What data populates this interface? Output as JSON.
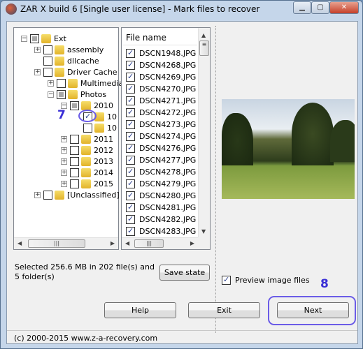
{
  "window": {
    "title": "ZAR X build 6 [Single user license] - Mark files to recover",
    "min": "▁",
    "max": "▢",
    "close": "✕"
  },
  "tree": {
    "items": [
      {
        "label": "Ext",
        "state": "partial",
        "expander": "−",
        "indent": 0
      },
      {
        "label": "assembly",
        "state": "unchecked",
        "expander": "+",
        "indent": 1
      },
      {
        "label": "dllcache",
        "state": "unchecked",
        "expander": "",
        "indent": 1
      },
      {
        "label": "Driver Cache",
        "state": "unchecked",
        "expander": "+",
        "indent": 1
      },
      {
        "label": "Multimedia",
        "state": "unchecked",
        "expander": "+",
        "indent": 2
      },
      {
        "label": "Photos",
        "state": "partial",
        "expander": "−",
        "indent": 2
      },
      {
        "label": "2010",
        "state": "partial",
        "expander": "−",
        "indent": 3
      },
      {
        "label": "10",
        "state": "checked",
        "expander": "",
        "indent": 4
      },
      {
        "label": "10",
        "state": "unchecked",
        "expander": "",
        "indent": 4
      },
      {
        "label": "2011",
        "state": "unchecked",
        "expander": "+",
        "indent": 3
      },
      {
        "label": "2012",
        "state": "unchecked",
        "expander": "+",
        "indent": 3
      },
      {
        "label": "2013",
        "state": "unchecked",
        "expander": "+",
        "indent": 3
      },
      {
        "label": "2014",
        "state": "unchecked",
        "expander": "+",
        "indent": 3
      },
      {
        "label": "2015",
        "state": "unchecked",
        "expander": "+",
        "indent": 3
      },
      {
        "label": "[Unclassified]",
        "state": "unchecked",
        "expander": "+",
        "indent": 1
      }
    ]
  },
  "files": {
    "header": "File name",
    "items": [
      "DSCN1948.JPG",
      "DSCN4268.JPG",
      "DSCN4269.JPG",
      "DSCN4270.JPG",
      "DSCN4271.JPG",
      "DSCN4272.JPG",
      "DSCN4273.JPG",
      "DSCN4274.JPG",
      "DSCN4276.JPG",
      "DSCN4277.JPG",
      "DSCN4278.JPG",
      "DSCN4279.JPG",
      "DSCN4280.JPG",
      "DSCN4281.JPG",
      "DSCN4282.JPG",
      "DSCN4283.JPG"
    ]
  },
  "status": "Selected 256.6 MB in 202 file(s) and 5 folder(s)",
  "buttons": {
    "save_state": "Save state",
    "help": "Help",
    "exit": "Exit",
    "next": "Next"
  },
  "preview": {
    "checkbox_label": "Preview image files",
    "checked": true
  },
  "annotations": {
    "step7": "7",
    "step8": "8"
  },
  "footer": "(c) 2000-2015 www.z-a-recovery.com",
  "colors": {
    "annotation": "#3a2fd6"
  }
}
